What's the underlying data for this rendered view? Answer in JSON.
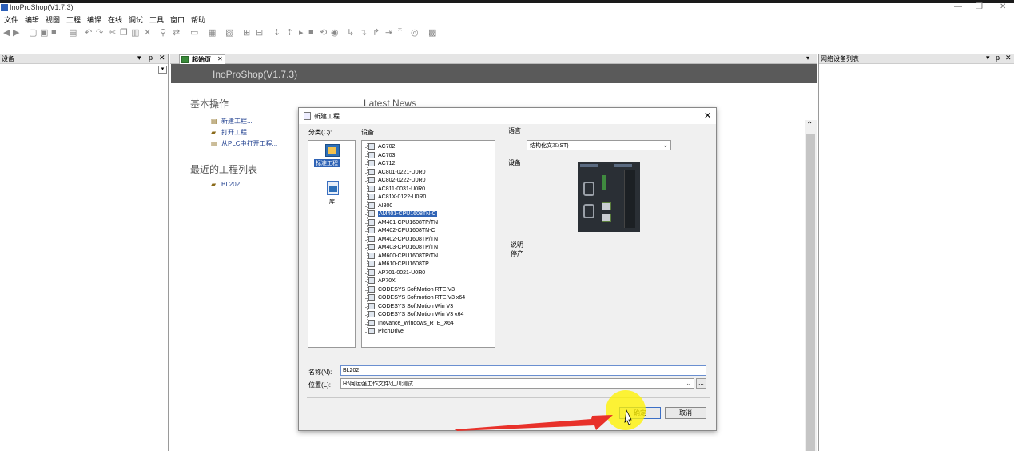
{
  "window": {
    "title": "InoProShop(V1.7.3)",
    "controls": [
      "—",
      "❐",
      "✕"
    ]
  },
  "menubar": {
    "items": [
      "文件",
      "编辑",
      "视图",
      "工程",
      "编译",
      "在线",
      "调试",
      "工具",
      "窗口",
      "帮助"
    ]
  },
  "left_panel": {
    "title": "设备",
    "controls": [
      "▾",
      "ᵽ",
      "✕"
    ]
  },
  "right_panel": {
    "title": "网络设备列表",
    "controls": [
      "▾",
      "ᵽ",
      "✕"
    ]
  },
  "doc_tab": {
    "label": "起始页",
    "close": "✕"
  },
  "start_page": {
    "banner": "InoProShop(V1.7.3)",
    "basic_ops_title": "基本操作",
    "latest_news_title": "Latest News",
    "links": [
      {
        "icon": "new-project-icon",
        "label": "新建工程..."
      },
      {
        "icon": "open-project-icon",
        "label": "打开工程..."
      },
      {
        "icon": "plc-open-icon",
        "label": "从PLC中打开工程..."
      }
    ],
    "recent_title": "最近的工程列表",
    "recent_items": [
      {
        "icon": "folder-icon",
        "label": "BL202"
      }
    ]
  },
  "dialog": {
    "title": "新建工程",
    "close": "✕",
    "category_label": "分类(C):",
    "device_label": "设备",
    "language_label": "语言",
    "device_preview_label": "设备",
    "description_label": "说明",
    "description_value": "停产",
    "categories": [
      {
        "icon": "standard-project-icon",
        "label": "标准工程",
        "selected": true
      },
      {
        "icon": "library-icon",
        "label": "库",
        "selected": false
      }
    ],
    "devices": [
      "AC702",
      "AC703",
      "AC712",
      "AC801-0221-U0R0",
      "AC802-0222-U0R0",
      "AC811-0031-U0R0",
      "AC81X-0122-U0R0",
      "AI800",
      "AM401-CPU1608TN-C",
      "AM401-CPU1608TP/TN",
      "AM402-CPU1608TN-C",
      "AM402-CPU1608TP/TN",
      "AM403-CPU1608TP/TN",
      "AM600-CPU1608TP/TN",
      "AM610-CPU1608TP",
      "AP701-0021-U0R0",
      "AP70X",
      "CODESYS SoftMotion RTE V3",
      "CODESYS Softmotion RTE V3 x64",
      "CODESYS SoftMotion Win V3",
      "CODESYS SoftMotion Win V3 x64",
      "Inovance_Windows_RTE_X64",
      "PitchDrive"
    ],
    "selected_device_index": 8,
    "language_value": "结构化文本(ST)",
    "name_label": "名称(N):",
    "name_value": "BL202",
    "location_label": "位置(L):",
    "location_value": "H:\\阿运强工作文件\\汇川测试",
    "browse_label": "...",
    "ok_label": "确定",
    "cancel_label": "取消"
  },
  "annotation": {
    "arrow_color": "#e8312a",
    "highlight_color": "#fff200"
  }
}
